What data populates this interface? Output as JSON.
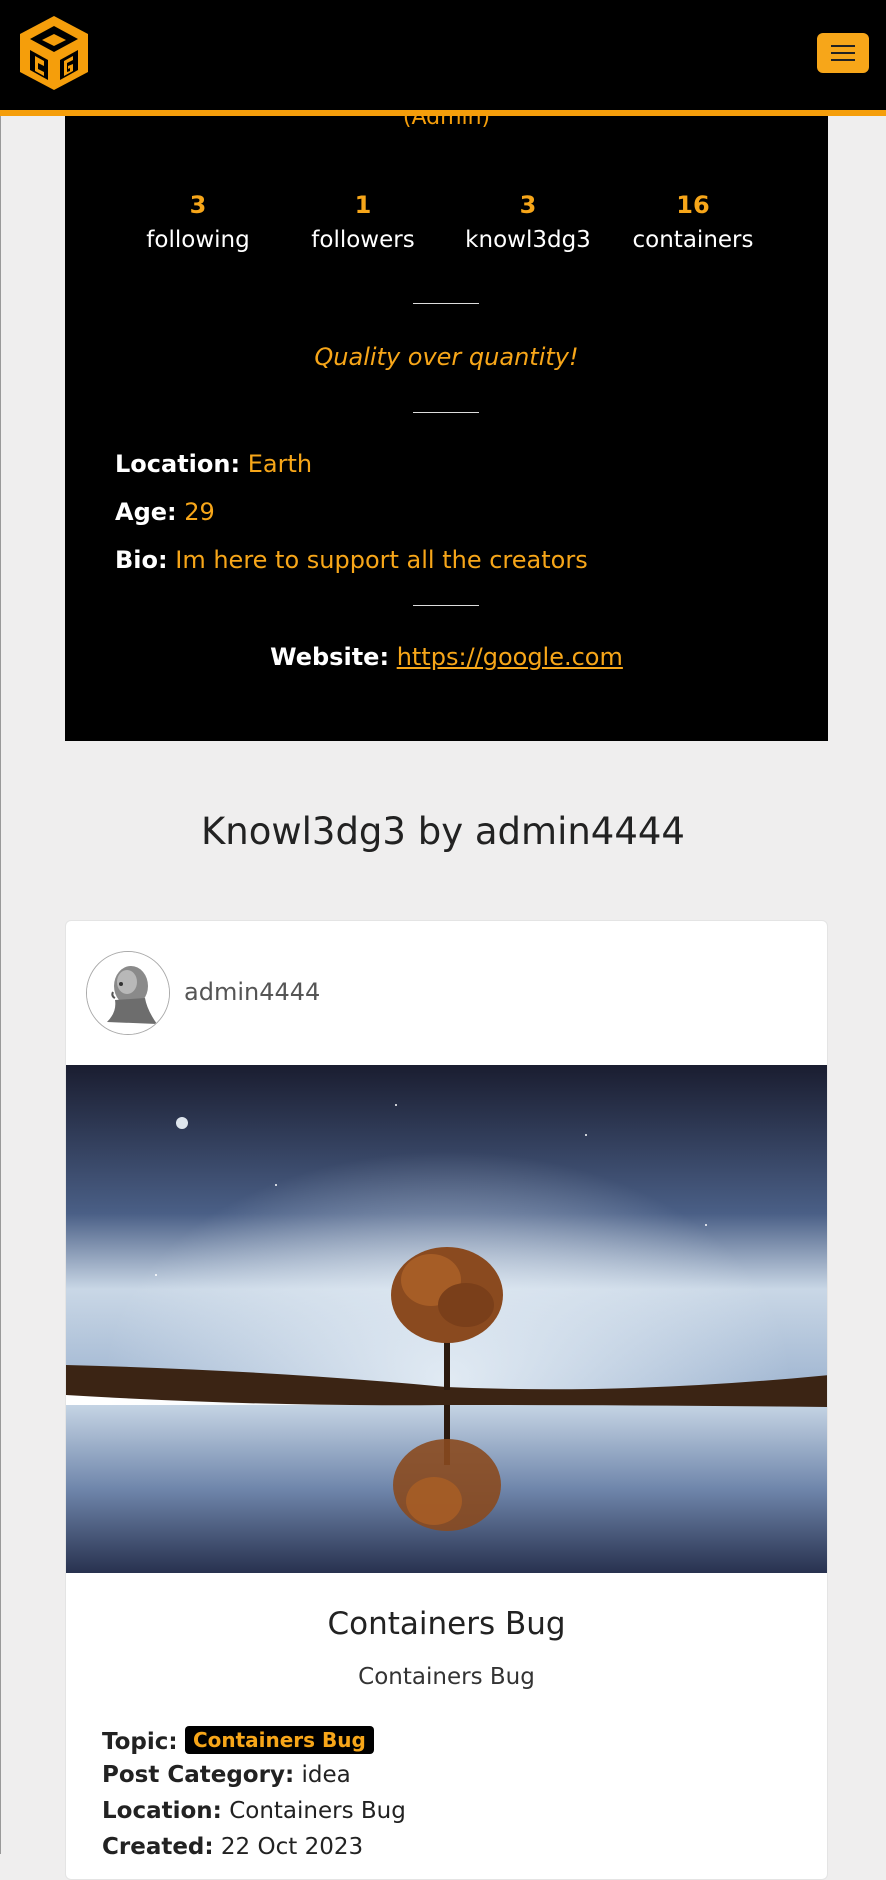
{
  "colors": {
    "accent": "#f59e0b",
    "panel": "#000000",
    "page_bg": "#efeeee"
  },
  "header": {
    "logo_icon": "cube-cg-logo-icon",
    "menu_icon": "hamburger-menu-icon"
  },
  "profile": {
    "role": "(Admin)",
    "stats": [
      {
        "count": "3",
        "label": "following"
      },
      {
        "count": "1",
        "label": "followers"
      },
      {
        "count": "3",
        "label": "knowl3dg3"
      },
      {
        "count": "16",
        "label": "containers"
      }
    ],
    "quote": "Quality over quantity!",
    "location_label": "Location:",
    "location": "Earth",
    "age_label": "Age:",
    "age": "29",
    "bio_label": "Bio:",
    "bio": "Im here to support all the creators",
    "website_label": "Website:",
    "website": "https://google.com"
  },
  "page_title": "Knowl3dg3 by admin4444",
  "post": {
    "author": "admin4444",
    "title": "Containers Bug",
    "subtitle": "Containers Bug",
    "topic_label": "Topic:",
    "topic": "Containers Bug",
    "category_label": "Post Category:",
    "category": "idea",
    "location_label": "Location:",
    "location": "Containers Bug",
    "created_label": "Created:",
    "created": "22 Oct 2023"
  }
}
